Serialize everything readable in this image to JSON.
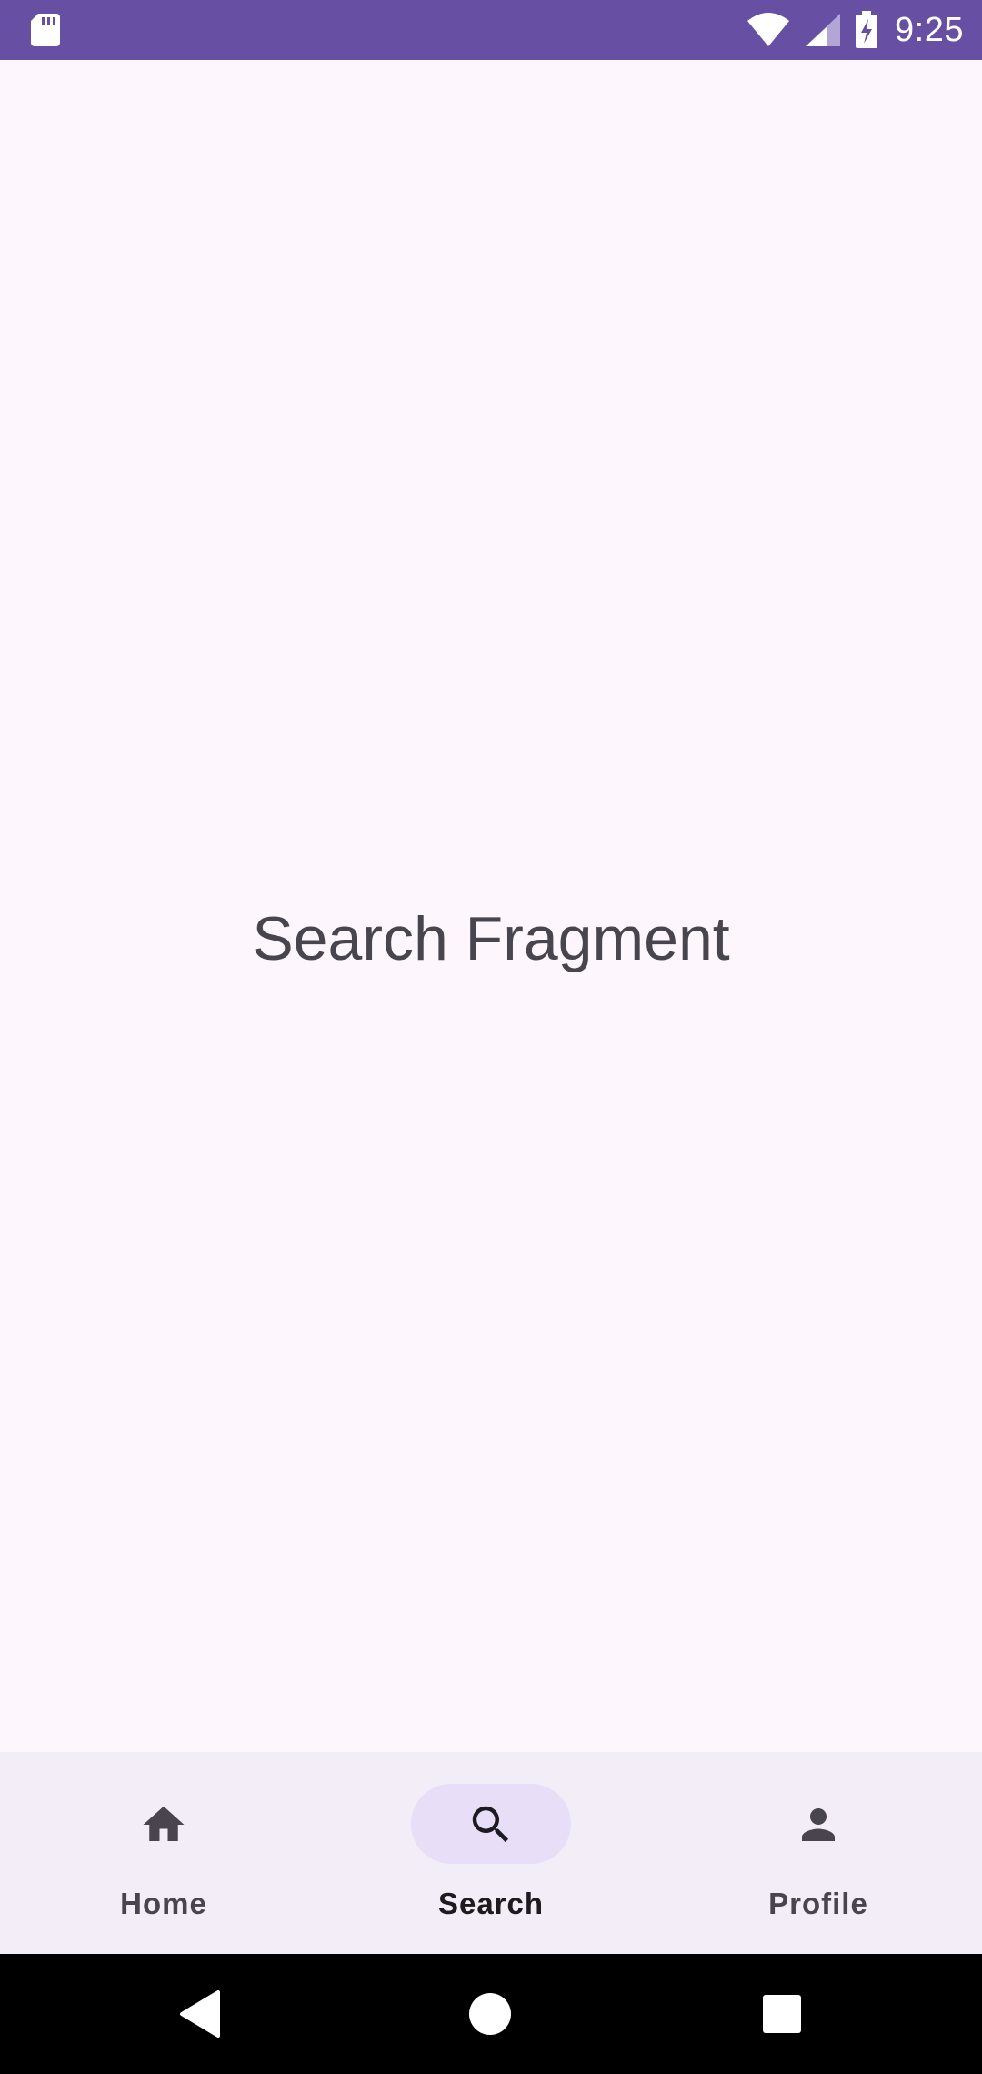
{
  "status_bar": {
    "time": "9:25",
    "background_color": "#6750a4",
    "icons": [
      "sd-card-icon",
      "wifi-icon",
      "signal-icon",
      "battery-charging-icon"
    ]
  },
  "content": {
    "fragment_title": "Search Fragment"
  },
  "bottom_nav": {
    "items": [
      {
        "label": "Home",
        "icon": "home-icon",
        "active": false
      },
      {
        "label": "Search",
        "icon": "search-icon",
        "active": true
      },
      {
        "label": "Profile",
        "icon": "person-icon",
        "active": false
      }
    ],
    "indicator_color": "#e8def8",
    "background_color": "#f2edf6"
  },
  "system_nav": {
    "buttons": [
      "back-icon",
      "home-circle-icon",
      "recents-icon"
    ]
  }
}
